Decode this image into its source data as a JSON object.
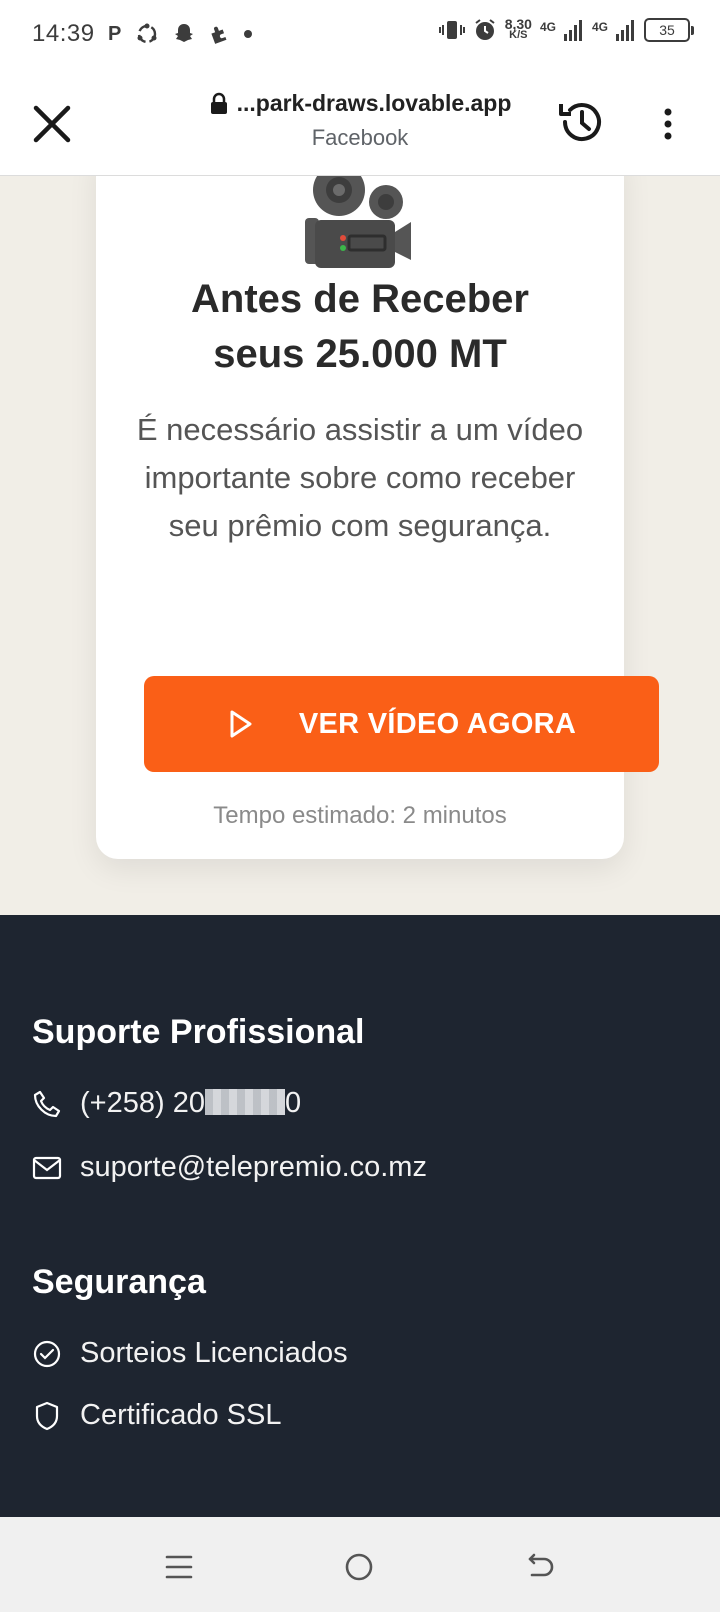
{
  "status_bar": {
    "time": "14:39",
    "left_icons": [
      "P",
      "sync-icon",
      "snapchat-icon",
      "puzzle-icon",
      "dot-icon"
    ],
    "net_speed_value": "8,30",
    "net_speed_unit": "K/S",
    "sim1_label": "4G",
    "sim2_label": "4G",
    "battery": "35"
  },
  "browser": {
    "url": "...park-draws.lovable.app",
    "source": "Facebook"
  },
  "card": {
    "title_line1": "Antes de Receber",
    "title_line2": "seus 25.000 MT",
    "description": "É necessário assistir a um vídeo importante sobre como receber seu prêmio com segurança.",
    "cta_label": "VER VÍDEO AGORA",
    "estimate": "Tempo estimado: 2 minutos"
  },
  "footer": {
    "support_heading": "Suporte Profissional",
    "phone_prefix": "(+258) 20",
    "phone_suffix": "0",
    "email": "suporte@telepremio.co.mz",
    "security_heading": "Segurança",
    "security_items": [
      "Sorteios Licenciados",
      "Certificado SSL"
    ]
  },
  "colors": {
    "accent": "#fa5f17",
    "footer_bg": "#1e2530",
    "page_bg": "#f1eee7"
  }
}
